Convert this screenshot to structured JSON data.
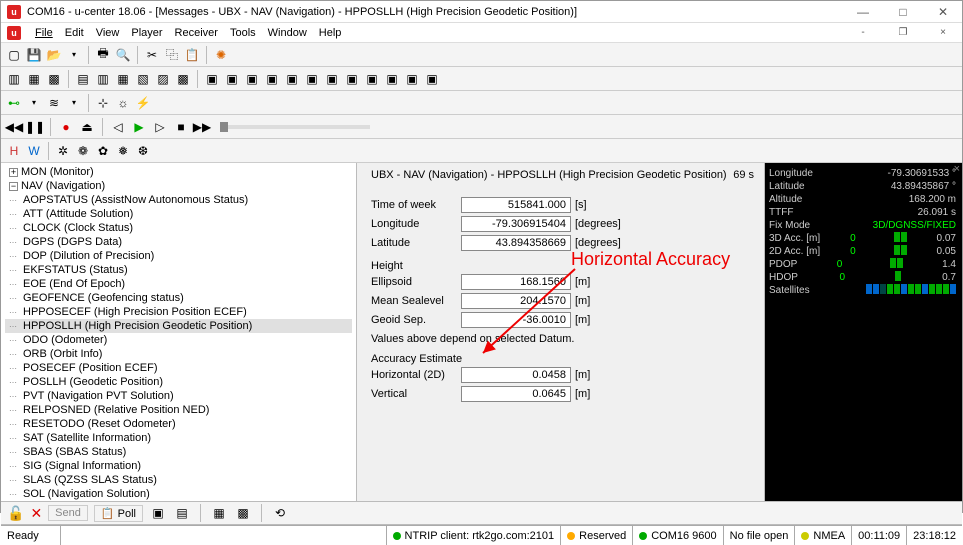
{
  "window": {
    "title": "COM16 - u-center 18.06 - [Messages - UBX - NAV (Navigation) - HPPOSLLH (High Precision Geodetic Position)]"
  },
  "menu": {
    "file": "File",
    "edit": "Edit",
    "view": "View",
    "player": "Player",
    "receiver": "Receiver",
    "tools": "Tools",
    "window": "Window",
    "help": "Help"
  },
  "tree": {
    "mon": "MON (Monitor)",
    "nav": "NAV (Navigation)",
    "items": [
      "AOPSTATUS (AssistNow Autonomous Status)",
      "ATT (Attitude Solution)",
      "CLOCK (Clock Status)",
      "DGPS (DGPS Data)",
      "DOP (Dilution of Precision)",
      "EKFSTATUS (Status)",
      "EOE (End Of Epoch)",
      "GEOFENCE (Geofencing status)",
      "HPPOSECEF (High Precision Position ECEF)",
      "HPPOSLLH (High Precision Geodetic Position)",
      "ODO (Odometer)",
      "ORB (Orbit Info)",
      "POSECEF (Position ECEF)",
      "POSLLH (Geodetic Position)",
      "PVT (Navigation PVT Solution)",
      "RELPOSNED (Relative Position NED)",
      "RESETODO (Reset Odometer)",
      "SAT (Satellite Information)",
      "SBAS (SBAS Status)",
      "SIG (Signal Information)",
      "SLAS (QZSS SLAS Status)",
      "SOL (Navigation Solution)"
    ]
  },
  "detail": {
    "header": "UBX - NAV (Navigation) - HPPOSLLH (High Precision Geodetic Position)",
    "age": "69 s",
    "tow_l": "Time of week",
    "tow_v": "515841.000",
    "tow_u": "[s]",
    "lon_l": "Longitude",
    "lon_v": "-79.306915404",
    "lon_u": "[degrees]",
    "lat_l": "Latitude",
    "lat_v": "43.894358669",
    "lat_u": "[degrees]",
    "height_l": "Height",
    "ell_l": "Ellipsoid",
    "ell_v": "168.1560",
    "ell_u": "[m]",
    "msl_l": "Mean Sealevel",
    "msl_v": "204.1570",
    "msl_u": "[m]",
    "geo_l": "Geoid Sep.",
    "geo_v": "-36.0010",
    "geo_u": "[m]",
    "datum_note": "Values above depend on selected Datum.",
    "acc_l": "Accuracy Estimate",
    "h2d_l": "Horizontal (2D)",
    "h2d_v": "0.0458",
    "h2d_u": "[m]",
    "vert_l": "Vertical",
    "vert_v": "0.0645",
    "vert_u": "[m]"
  },
  "blackpane": {
    "lon_l": "Longitude",
    "lon_v": "-79.30691533 °",
    "lat_l": "Latitude",
    "lat_v": "43.89435867 °",
    "alt_l": "Altitude",
    "alt_v": "168.200 m",
    "ttff_l": "TTFF",
    "ttff_v": "26.091 s",
    "fix_l": "Fix Mode",
    "fix_v": "3D/DGNSS/FIXED",
    "a3_l": "3D Acc. [m]",
    "a3_a": "0",
    "a3_b": "0.07",
    "a2_l": "2D Acc. [m]",
    "a2_a": "0",
    "a2_b": "0.05",
    "pd_l": "PDOP",
    "pd_a": "0",
    "pd_b": "1.4",
    "hd_l": "HDOP",
    "hd_a": "0",
    "hd_b": "0.7",
    "sat_l": "Satellites"
  },
  "annotation": "Horizontal Accuracy",
  "bottombar": {
    "send": "Send",
    "poll": "Poll"
  },
  "status": {
    "ready": "Ready",
    "ntrip": "NTRIP client: rtk2go.com:2101",
    "res": "Reserved",
    "com": "COM16 9600",
    "nofile": "No file open",
    "nmea": "NMEA",
    "t1": "00:11:09",
    "t2": "23:18:12"
  }
}
